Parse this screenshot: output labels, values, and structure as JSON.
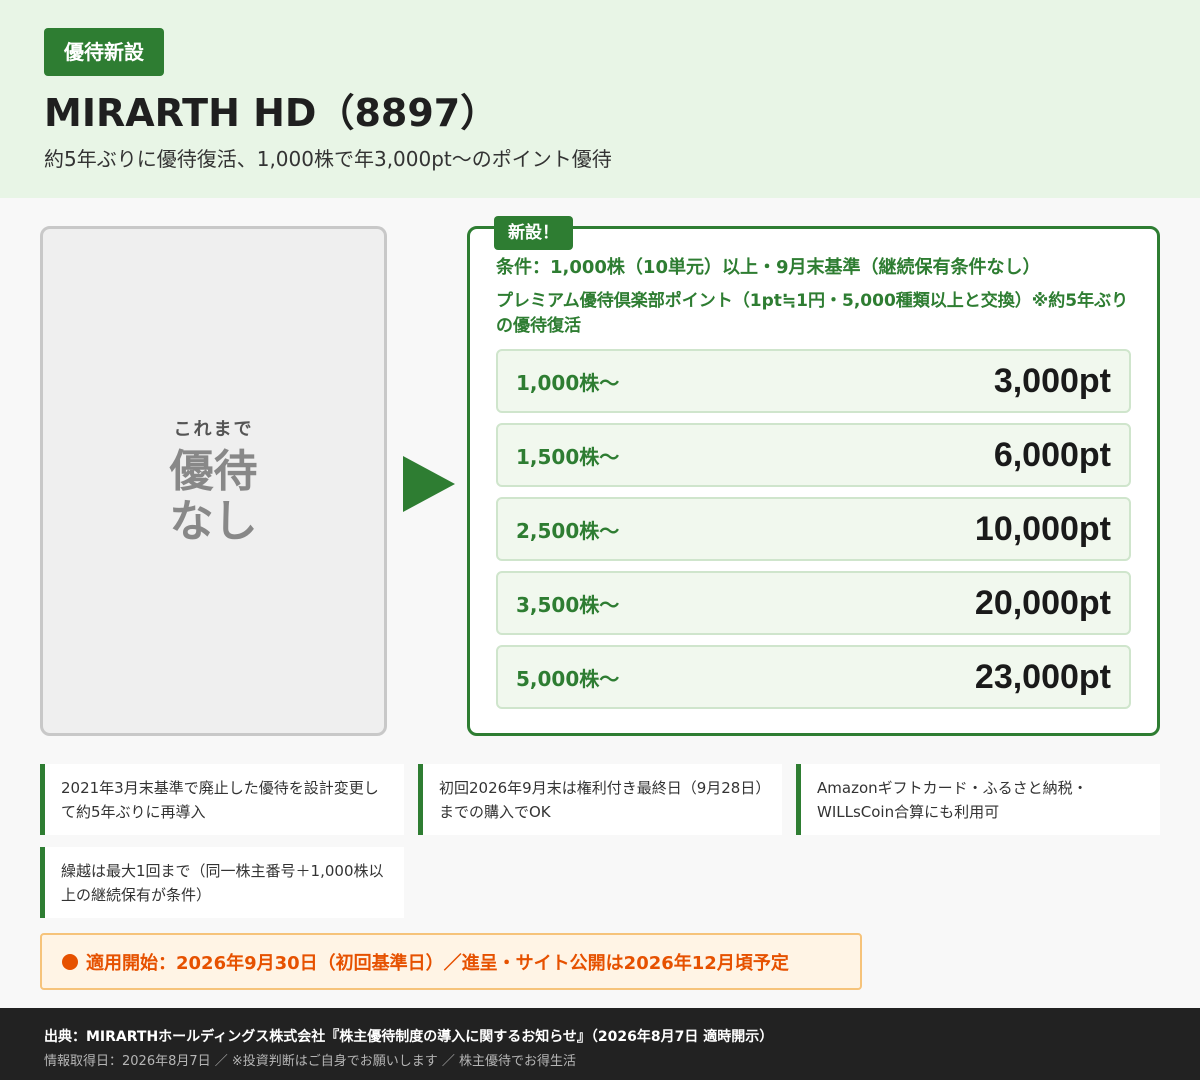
{
  "header": {
    "badge": "優待新設",
    "title": "MIRARTH HD（8897）",
    "subtitle": "約5年ぶりに優待復活、1,000株で年3,000pt〜のポイント優待"
  },
  "before": {
    "label": "これまで",
    "main_line1": "優待",
    "main_line2": "なし"
  },
  "after": {
    "tag": "新設！",
    "condition": "条件：1,000株（10単元）以上・9月末基準（継続保有条件なし）",
    "description": "プレミアム優待倶楽部ポイント（1pt≒1円・5,000種類以上と交換）※約5年ぶりの優待復活",
    "tiers": [
      {
        "shares": "1,000株〜",
        "points": "3,000pt"
      },
      {
        "shares": "1,500株〜",
        "points": "6,000pt"
      },
      {
        "shares": "2,500株〜",
        "points": "10,000pt"
      },
      {
        "shares": "3,500株〜",
        "points": "20,000pt"
      },
      {
        "shares": "5,000株〜",
        "points": "23,000pt"
      }
    ]
  },
  "notes": [
    "2021年3月末基準で廃止した優待を設計変更して約5年ぶりに再導入",
    "初回2026年9月末は権利付き最終日（9月28日）までの購入でOK",
    "Amazonギフトカード・ふるさと納税・WILLsCoin合算にも利用可",
    "繰越は最大1回まで（同一株主番号＋1,000株以上の継続保有が条件）"
  ],
  "start": "適用開始：2026年9月30日（初回基準日）／進呈・サイト公開は2026年12月頃予定",
  "footer": {
    "source": "出典：MIRARTHホールディングス株式会社『株主優待制度の導入に関するお知らせ』（2026年8月7日 適時開示）",
    "meta": "情報取得日：2026年8月7日 ／ ※投資判断はご自身でお願いします ／ 株主優待でお得生活"
  },
  "colors": {
    "brand_green": "#2e7d32",
    "header_bg": "#e8f5e6",
    "tier_bg": "#f1f8ee",
    "accent_orange": "#e65100",
    "footer_bg": "#222222"
  }
}
